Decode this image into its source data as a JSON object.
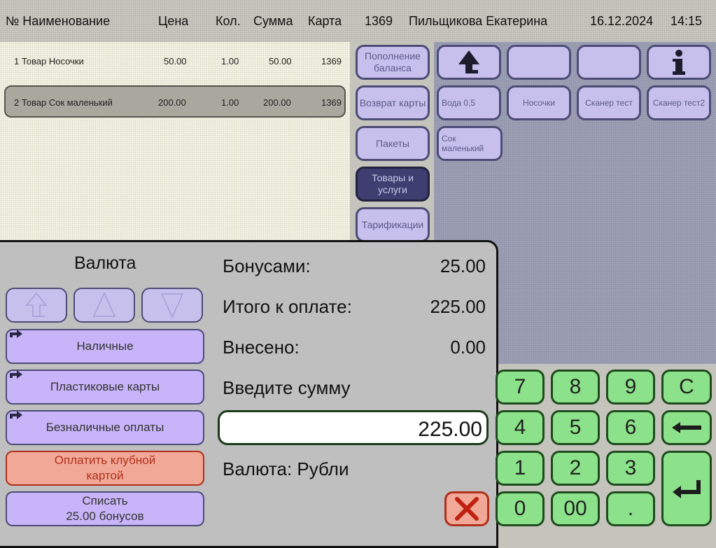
{
  "header": {
    "col_no_name": "№ Наименование",
    "col_price": "Цена",
    "col_qty": "Кол.",
    "col_sum": "Сумма",
    "col_card": "Карта",
    "card_number": "1369",
    "cashier": "Пильщикова Екатерина",
    "date": "16.12.2024",
    "time": "14:15"
  },
  "receipt": {
    "rows": [
      {
        "name": "1 Товар Носочки",
        "price": "50.00",
        "qty": "1.00",
        "sum": "50.00",
        "card": "1369",
        "selected": false
      },
      {
        "name": "2 Товар Сок маленький",
        "price": "200.00",
        "qty": "1.00",
        "sum": "200.00",
        "card": "1369",
        "selected": true
      }
    ]
  },
  "categories": [
    {
      "label": "Пополнение баланса",
      "active": false
    },
    {
      "label": "Возврат карты",
      "active": false
    },
    {
      "label": "Пакеты",
      "active": false
    },
    {
      "label": "Товары и услуги",
      "active": true
    },
    {
      "label": "Тарификации",
      "active": false
    }
  ],
  "toolbar_icons": [
    "up-arrow-icon",
    "info-icon"
  ],
  "products": [
    {
      "label": "Вода 0,5"
    },
    {
      "label": "Носочки"
    },
    {
      "label": "Сканер тест"
    },
    {
      "label": "Сканер тест2"
    },
    {
      "label": "Сок маленький"
    }
  ],
  "payment": {
    "currency_title": "Валюта",
    "methods": {
      "cash": "Наличные",
      "cards": "Пластиковые карты",
      "cashless": "Безналичные оплаты",
      "club_line1": "Оплатить клубной",
      "club_line2": "картой",
      "bonus_line1": "Списать",
      "bonus_line2": "25.00 бонусов"
    },
    "bonus_label": "Бонусами:",
    "bonus_value": "25.00",
    "total_label": "Итого к оплате:",
    "total_value": "225.00",
    "paid_label": "Внесено:",
    "paid_value": "0.00",
    "enter_label": "Введите сумму",
    "amount_value": "225.00",
    "currency_line": "Валюта: Рубли"
  },
  "keypad": {
    "k7": "7",
    "k8": "8",
    "k9": "9",
    "kc": "C",
    "k4": "4",
    "k5": "5",
    "k6": "6",
    "k1": "1",
    "k2": "2",
    "k3": "3",
    "k0": "0",
    "k00": "00",
    "kdot": "."
  },
  "colors": {
    "receipt_bg": "#f3f3e6",
    "selected_row": "#a8a89e",
    "category_btn": "#c8c0ec",
    "category_active": "#3f3e70",
    "payment_btn": "#c8b4f8",
    "club_btn": "#f2a896",
    "keypad": "#8ce28a"
  }
}
